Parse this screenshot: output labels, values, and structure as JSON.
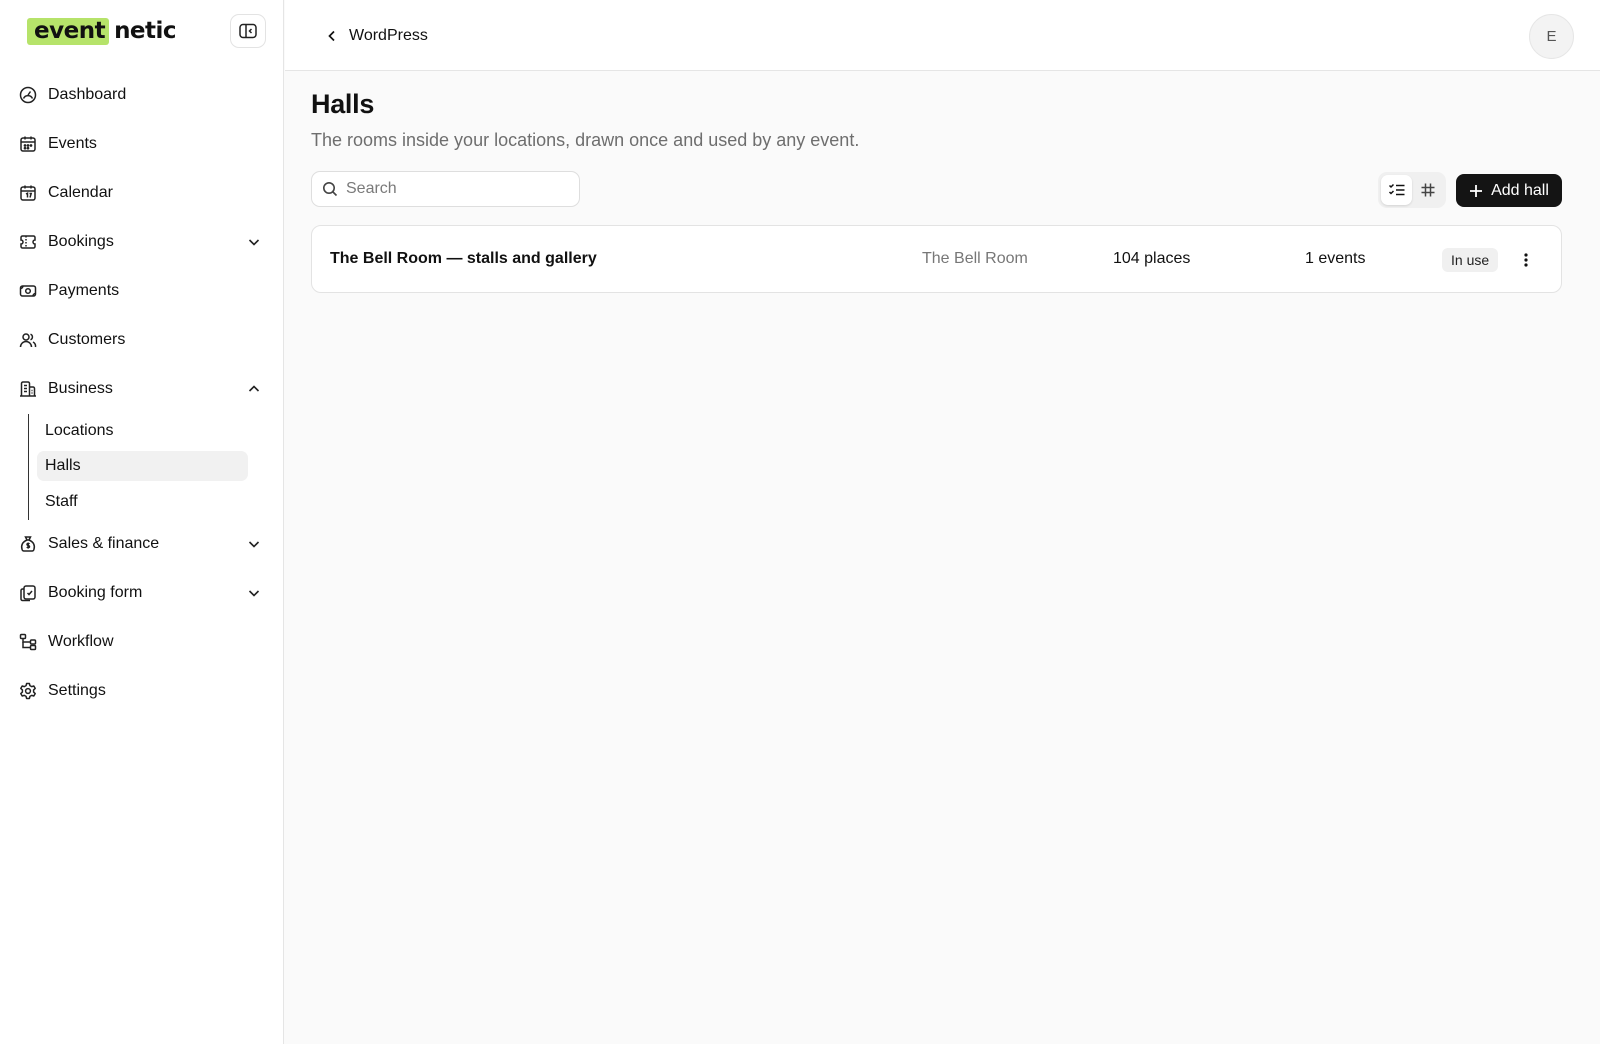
{
  "brand": {
    "part1": "event",
    "part2": "netic"
  },
  "sidebar": {
    "items": [
      {
        "label": "Dashboard",
        "icon": "dashboard-icon"
      },
      {
        "label": "Events",
        "icon": "calendar-icon"
      },
      {
        "label": "Calendar",
        "icon": "calendar-day-icon"
      },
      {
        "label": "Bookings",
        "icon": "ticket-icon",
        "expandable": true,
        "expanded": false
      },
      {
        "label": "Payments",
        "icon": "money-icon"
      },
      {
        "label": "Customers",
        "icon": "users-icon"
      },
      {
        "label": "Business",
        "icon": "building-icon",
        "expandable": true,
        "expanded": true
      },
      {
        "label": "Sales & finance",
        "icon": "money-bag-icon",
        "expandable": true,
        "expanded": false
      },
      {
        "label": "Booking form",
        "icon": "form-icon",
        "expandable": true,
        "expanded": false
      },
      {
        "label": "Workflow",
        "icon": "workflow-icon"
      },
      {
        "label": "Settings",
        "icon": "gear-icon"
      }
    ],
    "business_sub": [
      {
        "label": "Locations",
        "active": false
      },
      {
        "label": "Halls",
        "active": true
      },
      {
        "label": "Staff",
        "active": false
      }
    ]
  },
  "topbar": {
    "back_label": "WordPress",
    "avatar_initial": "E"
  },
  "page": {
    "title": "Halls",
    "subtitle": "The rooms inside your locations, drawn once and used by any event.",
    "search_placeholder": "Search",
    "add_label": "Add hall",
    "view_mode": "list"
  },
  "halls": [
    {
      "name": "The Bell Room — stalls and gallery",
      "location": "The Bell Room",
      "capacity": "104 places",
      "events": "1 events",
      "status": "In use"
    }
  ],
  "colors": {
    "brand_highlight": "#b6e36a",
    "primary_button": "#141414"
  }
}
